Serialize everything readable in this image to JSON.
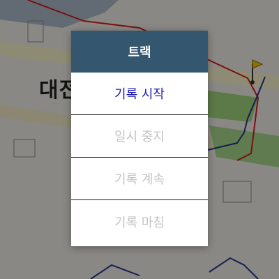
{
  "map": {
    "place_label": "대전화가전",
    "marker_icon": "flag-pin-icon"
  },
  "dialog": {
    "title": "트랙",
    "items": [
      {
        "label": "기록 시작",
        "enabled": true
      },
      {
        "label": "일시 중지",
        "enabled": false
      },
      {
        "label": "기록 계속",
        "enabled": false
      },
      {
        "label": "기록 마침",
        "enabled": false
      }
    ]
  },
  "colors": {
    "header_bg": "#34566f",
    "active_text": "#1a18b8",
    "disabled_text": "#c4c4c4",
    "route_red": "#d31b1b",
    "route_blue": "#27348b",
    "park_green": "#7bc24a"
  }
}
